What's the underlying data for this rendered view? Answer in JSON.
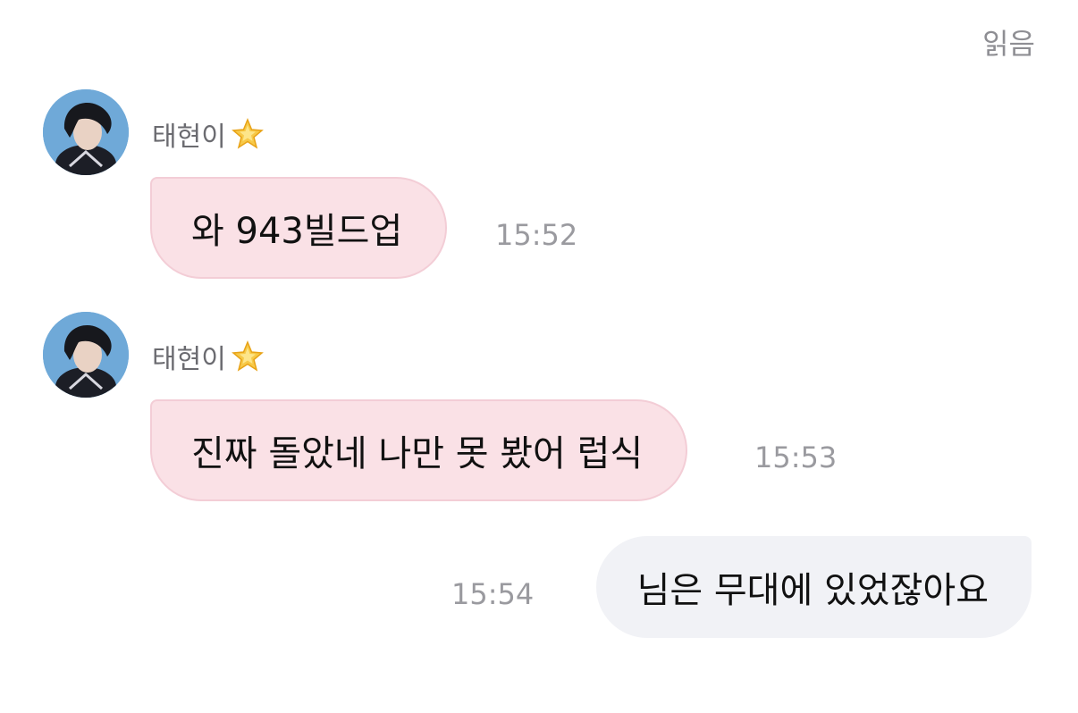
{
  "header": {
    "read_status": "읽음"
  },
  "messages": [
    {
      "sender": "태현이",
      "text": "와 943빌드업",
      "time": "15:52"
    },
    {
      "sender": "태현이",
      "text": "진짜 돌았네 나만 못 봤어 럽식",
      "time": "15:53"
    },
    {
      "text": "님은 무대에 있었잖아요",
      "time": "15:54"
    }
  ],
  "colors": {
    "incoming_bubble": "#fae1e6",
    "outgoing_bubble": "#f1f2f6",
    "timestamp": "#9a9a9f"
  },
  "icons": {
    "sender_badge": "sparkle-star-icon",
    "avatar": "profile-photo"
  }
}
